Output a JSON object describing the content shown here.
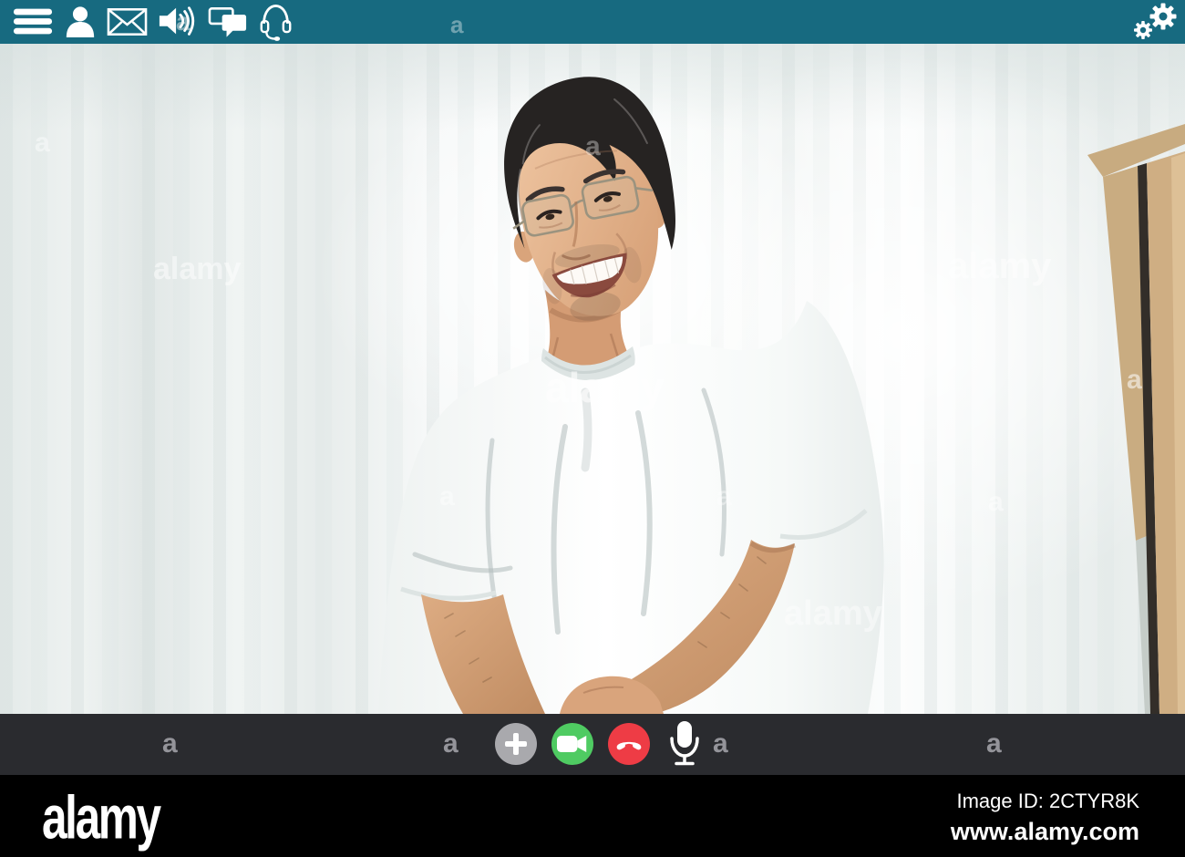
{
  "app": {
    "type": "video-call-app-mockup"
  },
  "header": {
    "background": "#176a80",
    "icons": [
      {
        "name": "menu"
      },
      {
        "name": "user"
      },
      {
        "name": "mail"
      },
      {
        "name": "volume"
      },
      {
        "name": "chat"
      },
      {
        "name": "support-headset"
      },
      {
        "name": "settings-gears"
      }
    ],
    "watermark_letter": "a"
  },
  "video": {
    "description": "Smiling middle-aged man with wire glasses and white t-shirt leaning forward in front of sheer white curtains; wooden mirror frame at right",
    "watermarks": {
      "brand": "alamy",
      "letter": "a"
    }
  },
  "controls": {
    "background": "#2a2b2f",
    "buttons": [
      {
        "name": "add-participant",
        "color": "#a9a9ad"
      },
      {
        "name": "video-camera",
        "color": "#4fcb62"
      },
      {
        "name": "end-call",
        "color": "#ee3c45"
      },
      {
        "name": "microphone",
        "color": "transparent"
      }
    ],
    "watermark_letter": "a"
  },
  "footer": {
    "background": "#000000",
    "logo": "alamy",
    "image_id_label": "Image ID: 2CTYR8K",
    "url": "www.alamy.com"
  }
}
